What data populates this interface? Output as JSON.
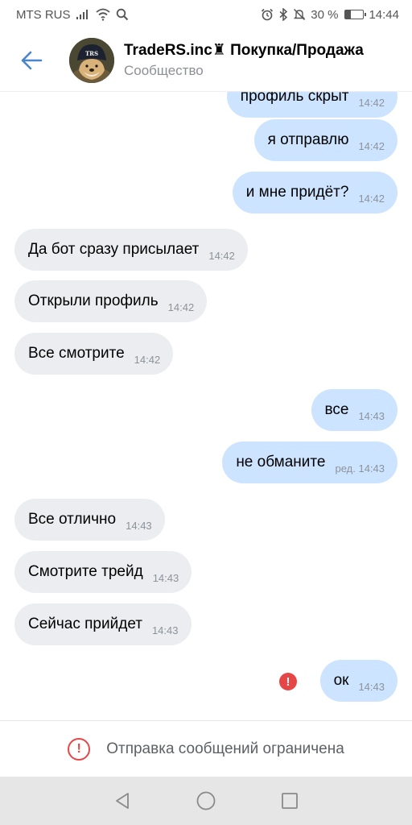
{
  "status_bar": {
    "carrier": "MTS RUS",
    "battery_percent": "30 %",
    "battery_level": 0.3,
    "time": "14:44",
    "icons": [
      "signal-icon",
      "wifi-icon",
      "search-icon",
      "alarm-icon",
      "bluetooth-icon",
      "mute-icon",
      "battery-icon"
    ]
  },
  "header": {
    "title": "TradeRS.inc♜ Покупка/Продажа",
    "subtitle": "Сообщество",
    "avatar_text": "TRS"
  },
  "messages": [
    {
      "direction": "out",
      "text": "профиль скрыт",
      "time": "14:42"
    },
    {
      "direction": "out",
      "text": "я отправлю",
      "time": "14:42"
    },
    {
      "direction": "out",
      "text": "и мне придёт?",
      "time": "14:42"
    },
    {
      "direction": "in",
      "text": "Да бот сразу присылает",
      "time": "14:42"
    },
    {
      "direction": "in",
      "text": "Открыли профиль",
      "time": "14:42"
    },
    {
      "direction": "in",
      "text": "Все смотрите",
      "time": "14:42"
    },
    {
      "direction": "out",
      "text": "все",
      "time": "14:43"
    },
    {
      "direction": "out",
      "text": "не обманите",
      "time": "ред. 14:43"
    },
    {
      "direction": "in",
      "text": "Все отлично",
      "time": "14:43"
    },
    {
      "direction": "in",
      "text": "Смотрите трейд",
      "time": "14:43"
    },
    {
      "direction": "in",
      "text": "Сейчас прийдет",
      "time": "14:43"
    },
    {
      "direction": "out",
      "text": "ок",
      "time": "14:43",
      "error": true
    }
  ],
  "restriction": {
    "text": "Отправка сообщений ограничена"
  },
  "colors": {
    "outgoing_bubble": "#cce4ff",
    "incoming_bubble": "#ebedf0",
    "accent": "#4a86c8",
    "error": "#e64646"
  }
}
